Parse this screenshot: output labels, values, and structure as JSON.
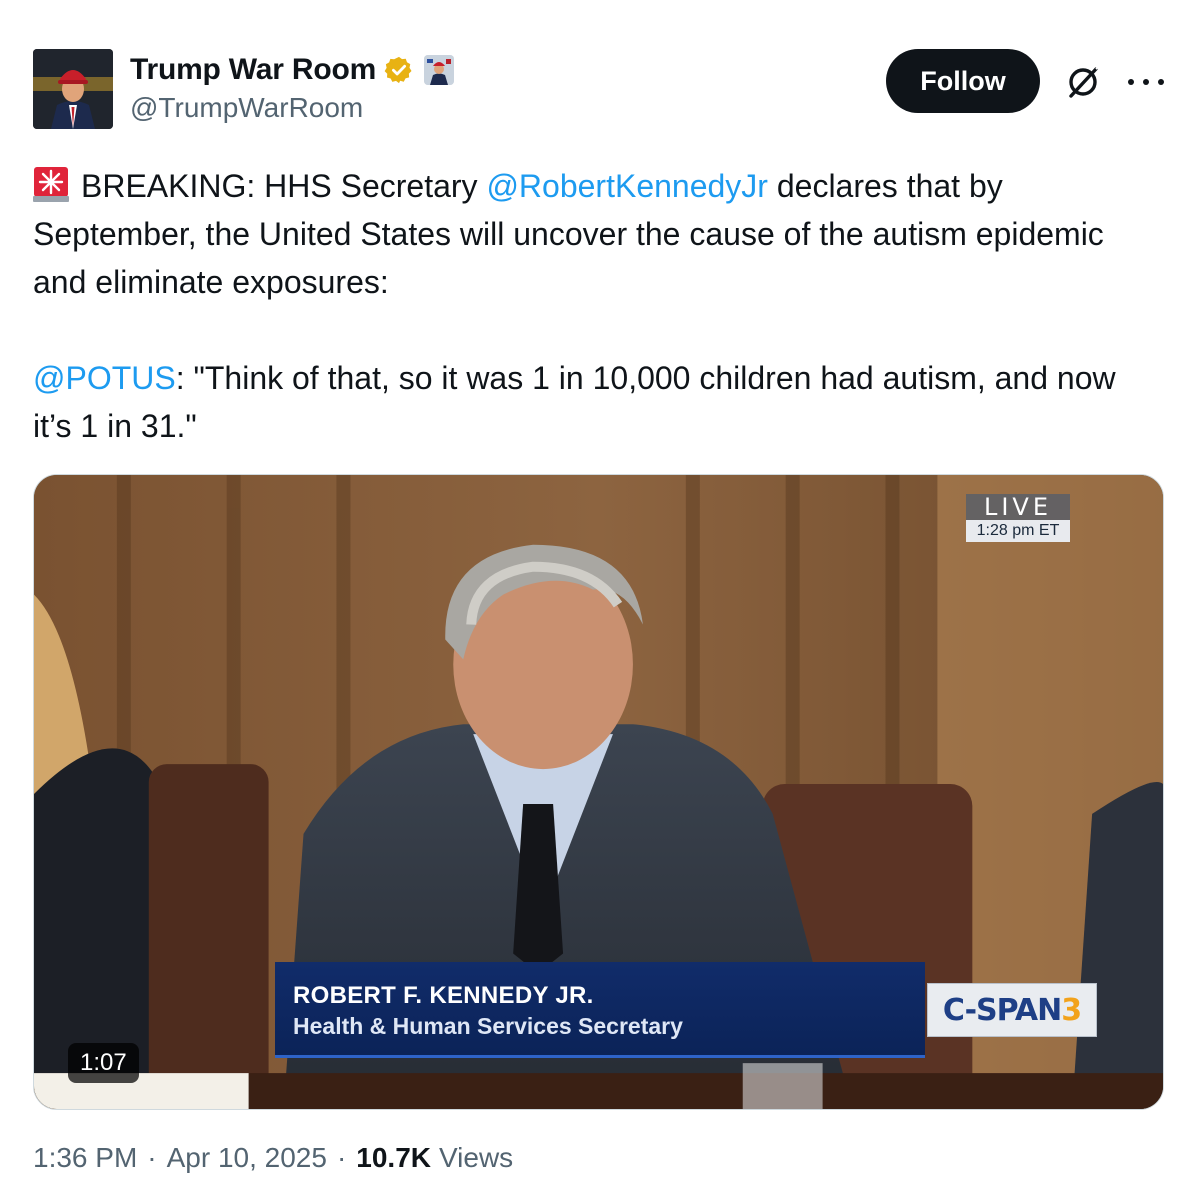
{
  "author": {
    "display_name": "Trump War Room",
    "handle": "@TrumpWarRoom",
    "verified_badge_color": "#e8b213"
  },
  "actions": {
    "follow_label": "Follow"
  },
  "tweet": {
    "siren_icon": "rotating-light-icon",
    "line1_prefix": "BREAKING: HHS Secretary ",
    "line1_mention": "@RobertKennedyJr",
    "line1_suffix": " declares that by September, the United States will uncover the cause of the autism epidemic and eliminate exposures:",
    "quote_mention": "@POTUS",
    "quote_text": ": \"Think of that, so it was 1 in 10,000 children had autism, and now it’s 1 in 31.\"",
    "mention_color": "#1d9bf0"
  },
  "video": {
    "live_label": "LIVE",
    "live_time": "1:28 pm ET",
    "lower_third_name": "ROBERT F. KENNEDY JR.",
    "lower_third_title": "Health & Human Services Secretary",
    "network_logo_main": "C-SPAN",
    "network_logo_number": "3",
    "duration": "1:07"
  },
  "meta": {
    "time": "1:36 PM",
    "date": "Apr 10, 2025",
    "views_count": "10.7K",
    "views_label": "Views",
    "separator": "·"
  }
}
